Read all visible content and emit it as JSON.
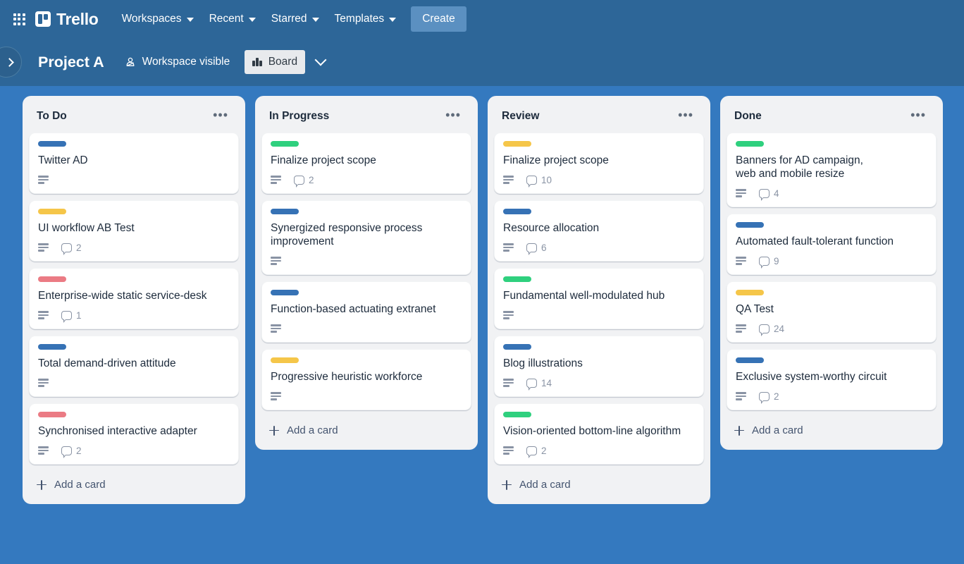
{
  "topnav": {
    "apps_icon": "apps-grid-icon",
    "brand": "Trello",
    "items": [
      {
        "label": "Workspaces"
      },
      {
        "label": "Recent"
      },
      {
        "label": "Starred"
      },
      {
        "label": "Templates"
      }
    ],
    "create_label": "Create"
  },
  "boardheader": {
    "sidebar_toggle_icon": "chevron-right-icon",
    "title": "Project A",
    "visibility_icon": "workspace-visible-icon",
    "visibility_label": "Workspace visible",
    "view_icon": "board-view-icon",
    "view_label": "Board",
    "view_caret_icon": "chevron-down-icon"
  },
  "colors": {
    "nav_bg": "#2d6698",
    "board_bg": "#3479bf",
    "list_bg": "#f1f2f4",
    "card_bg": "#ffffff",
    "label_blue": "#3672b5",
    "label_green": "#2fd07e",
    "label_yellow": "#f5c649",
    "label_red": "#eb7b84",
    "create_btn": "#5b90c1"
  },
  "add_card_label": "Add a card",
  "list_menu_glyph": "•••",
  "lists": [
    {
      "title": "To Do",
      "cards": [
        {
          "label_color": "blue",
          "title": "Twitter AD",
          "has_description": true,
          "comments": null
        },
        {
          "label_color": "yellow",
          "title": "UI workflow AB Test",
          "has_description": true,
          "comments": "2"
        },
        {
          "label_color": "red",
          "title": "Enterprise-wide static service-desk",
          "has_description": true,
          "comments": "1"
        },
        {
          "label_color": "blue",
          "title": "Total demand-driven attitude",
          "has_description": true,
          "comments": null
        },
        {
          "label_color": "red",
          "title": "Synchronised interactive adapter",
          "has_description": true,
          "comments": "2"
        }
      ]
    },
    {
      "title": "In Progress",
      "cards": [
        {
          "label_color": "green",
          "title": "Finalize project scope",
          "has_description": true,
          "comments": "2"
        },
        {
          "label_color": "blue",
          "title": "Synergized responsive process\nimprovement",
          "has_description": true,
          "comments": null
        },
        {
          "label_color": "blue",
          "title": "Function-based actuating extranet",
          "has_description": true,
          "comments": null
        },
        {
          "label_color": "yellow",
          "title": "Progressive heuristic workforce",
          "has_description": true,
          "comments": null
        }
      ]
    },
    {
      "title": "Review",
      "cards": [
        {
          "label_color": "yellow",
          "title": "Finalize project scope",
          "has_description": true,
          "comments": "10"
        },
        {
          "label_color": "blue",
          "title": "Resource allocation",
          "has_description": true,
          "comments": "6"
        },
        {
          "label_color": "green",
          "title": "Fundamental well-modulated hub",
          "has_description": true,
          "comments": null
        },
        {
          "label_color": "blue",
          "title": "Blog illustrations",
          "has_description": true,
          "comments": "14"
        },
        {
          "label_color": "green",
          "title": "Vision-oriented bottom-line algorithm",
          "has_description": true,
          "comments": "2"
        }
      ]
    },
    {
      "title": "Done",
      "cards": [
        {
          "label_color": "green",
          "title": "Banners for AD campaign,\nweb and mobile resize",
          "has_description": true,
          "comments": "4"
        },
        {
          "label_color": "blue",
          "title": "Automated fault-tolerant function",
          "has_description": true,
          "comments": "9"
        },
        {
          "label_color": "yellow",
          "title": "QA Test",
          "has_description": true,
          "comments": "24"
        },
        {
          "label_color": "blue",
          "title": "Exclusive system-worthy circuit",
          "has_description": true,
          "comments": "2"
        }
      ]
    }
  ]
}
